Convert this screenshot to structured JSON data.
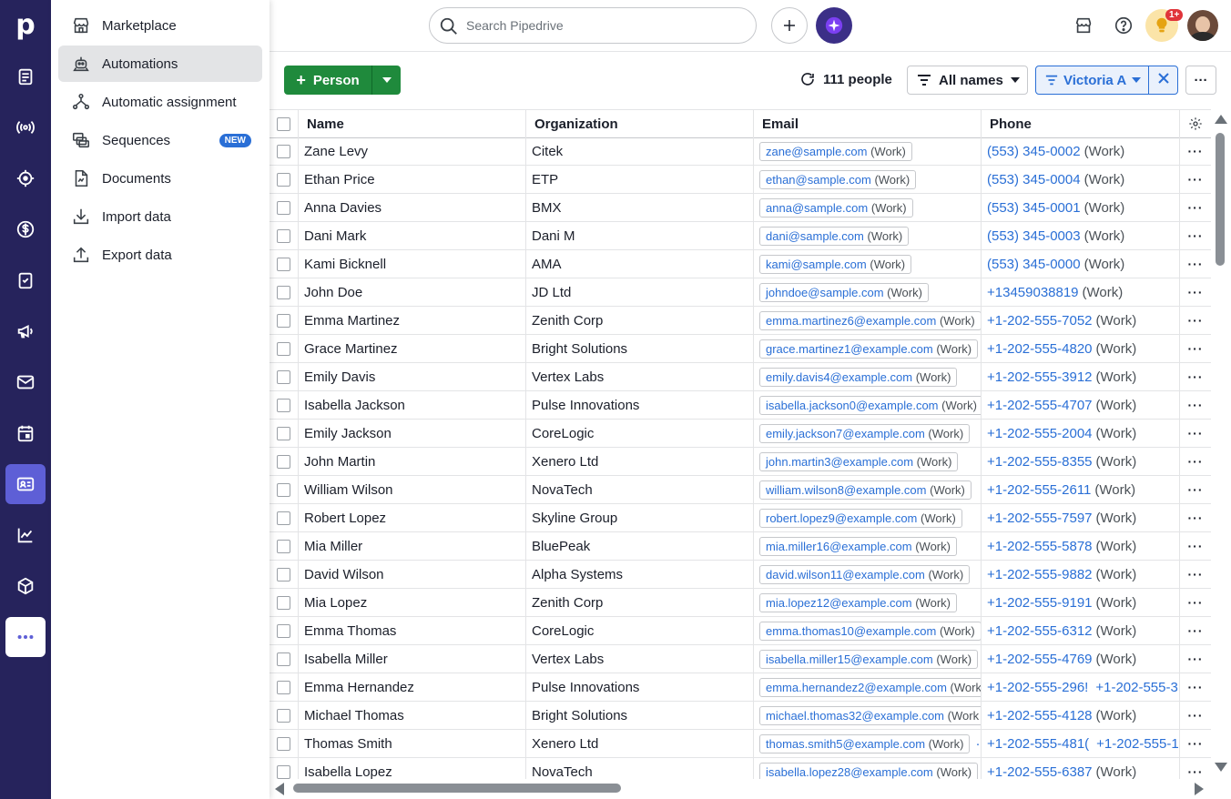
{
  "app": {
    "logo_letter": "p"
  },
  "rail": {
    "items": [
      {
        "name": "leads-icon"
      },
      {
        "name": "campaigns-radar-icon"
      },
      {
        "name": "target-icon"
      },
      {
        "name": "deals-dollar-icon"
      },
      {
        "name": "activities-check-icon"
      },
      {
        "name": "megaphone-icon"
      },
      {
        "name": "mail-icon"
      },
      {
        "name": "calendar-icon"
      },
      {
        "name": "contacts-card-icon"
      },
      {
        "name": "insights-chart-icon"
      },
      {
        "name": "products-box-icon"
      },
      {
        "name": "more-icon"
      }
    ],
    "colors": {
      "rail_bg": "#26235c",
      "active_bg": "#5e5fd6"
    }
  },
  "menu": {
    "items": [
      {
        "label": "Marketplace",
        "icon": "store-icon"
      },
      {
        "label": "Automations",
        "icon": "robot-icon"
      },
      {
        "label": "Automatic assignment",
        "icon": "assignment-icon"
      },
      {
        "label": "Sequences",
        "icon": "sequences-icon",
        "badge": "NEW"
      },
      {
        "label": "Documents",
        "icon": "document-icon"
      },
      {
        "label": "Import data",
        "icon": "import-icon"
      },
      {
        "label": "Export data",
        "icon": "export-icon"
      }
    ]
  },
  "topbar": {
    "search_placeholder": "Search Pipedrive",
    "notification_count": "1+"
  },
  "toolbar": {
    "add_label": "Person",
    "count_label": "111 people",
    "all_names_label": "All names",
    "filter_label": "Victoria A"
  },
  "table": {
    "columns": [
      "Name",
      "Organization",
      "Email",
      "Phone"
    ],
    "rows": [
      {
        "name": "Zane Levy",
        "org": "Citek",
        "email": "zane@sample.com",
        "email_type": "(Work)",
        "phone": "(553) 345-0002",
        "phone_type": "(Work)"
      },
      {
        "name": "Ethan Price",
        "org": "ETP",
        "email": "ethan@sample.com",
        "email_type": "(Work)",
        "phone": "(553) 345-0004",
        "phone_type": "(Work)"
      },
      {
        "name": "Anna Davies",
        "org": "BMX",
        "email": "anna@sample.com",
        "email_type": "(Work)",
        "phone": "(553) 345-0001",
        "phone_type": "(Work)"
      },
      {
        "name": "Dani Mark",
        "org": "Dani M",
        "email": "dani@sample.com",
        "email_type": "(Work)",
        "phone": "(553) 345-0003",
        "phone_type": "(Work)"
      },
      {
        "name": "Kami Bicknell",
        "org": "AMA",
        "email": "kami@sample.com",
        "email_type": "(Work)",
        "phone": "(553) 345-0000",
        "phone_type": "(Work)"
      },
      {
        "name": "John Doe",
        "org": "JD Ltd",
        "email": "johndoe@sample.com",
        "email_type": "(Work)",
        "phone": "+13459038819",
        "phone_type": "(Work)"
      },
      {
        "name": "Emma Martinez",
        "org": "Zenith Corp",
        "email": "emma.martinez6@example.com",
        "email_type": "(Work)",
        "phone": "+1-202-555-7052",
        "phone_type": "(Work)"
      },
      {
        "name": "Grace Martinez",
        "org": "Bright Solutions",
        "email": "grace.martinez1@example.com",
        "email_type": "(Work)",
        "phone": "+1-202-555-4820",
        "phone_type": "(Work)"
      },
      {
        "name": "Emily Davis",
        "org": "Vertex Labs",
        "email": "emily.davis4@example.com",
        "email_type": "(Work)",
        "phone": "+1-202-555-3912",
        "phone_type": "(Work)"
      },
      {
        "name": "Isabella Jackson",
        "org": "Pulse Innovations",
        "email": "isabella.jackson0@example.com",
        "email_type": "(Work)",
        "phone": "+1-202-555-4707",
        "phone_type": "(Work)"
      },
      {
        "name": "Emily Jackson",
        "org": "CoreLogic",
        "email": "emily.jackson7@example.com",
        "email_type": "(Work)",
        "phone": "+1-202-555-2004",
        "phone_type": "(Work)"
      },
      {
        "name": "John Martin",
        "org": "Xenero Ltd",
        "email": "john.martin3@example.com",
        "email_type": "(Work)",
        "phone": "+1-202-555-8355",
        "phone_type": "(Work)"
      },
      {
        "name": "William Wilson",
        "org": "NovaTech",
        "email": "william.wilson8@example.com",
        "email_type": "(Work)",
        "phone": "+1-202-555-2611",
        "phone_type": "(Work)"
      },
      {
        "name": "Robert Lopez",
        "org": "Skyline Group",
        "email": "robert.lopez9@example.com",
        "email_type": "(Work)",
        "phone": "+1-202-555-7597",
        "phone_type": "(Work)"
      },
      {
        "name": "Mia Miller",
        "org": "BluePeak",
        "email": "mia.miller16@example.com",
        "email_type": "(Work)",
        "phone": "+1-202-555-5878",
        "phone_type": "(Work)"
      },
      {
        "name": "David Wilson",
        "org": "Alpha Systems",
        "email": "david.wilson11@example.com",
        "email_type": "(Work)",
        "phone": "+1-202-555-9882",
        "phone_type": "(Work)"
      },
      {
        "name": "Mia Lopez",
        "org": "Zenith Corp",
        "email": "mia.lopez12@example.com",
        "email_type": "(Work)",
        "phone": "+1-202-555-9191",
        "phone_type": "(Work)"
      },
      {
        "name": "Emma Thomas",
        "org": "CoreLogic",
        "email": "emma.thomas10@example.com",
        "email_type": "(Work)",
        "phone": "+1-202-555-6312",
        "phone_type": "(Work)"
      },
      {
        "name": "Isabella Miller",
        "org": "Vertex Labs",
        "email": "isabella.miller15@example.com",
        "email_type": "(Work)",
        "phone": "+1-202-555-4769",
        "phone_type": "(Work)"
      },
      {
        "name": "Emma Hernandez",
        "org": "Pulse Innovations",
        "email": "emma.hernandez2@example.com",
        "email_type": "(Work",
        "phone": "+1-202-555-296!",
        "phone_type": "",
        "phone2": "+1-202-555-3"
      },
      {
        "name": "Michael Thomas",
        "org": "Bright Solutions",
        "email": "michael.thomas32@example.com",
        "email_type": "(Work",
        "phone": "+1-202-555-4128",
        "phone_type": "(Work)"
      },
      {
        "name": "Thomas Smith",
        "org": "Xenero Ltd",
        "email": "thomas.smith5@example.com",
        "email_type": "(Work)",
        "extra": "··",
        "phone": "+1-202-555-481(",
        "phone_type": "",
        "phone2": "+1-202-555-1"
      },
      {
        "name": "Isabella Lopez",
        "org": "NovaTech",
        "email": "isabella.lopez28@example.com",
        "email_type": "(Work)",
        "phone": "+1-202-555-6387",
        "phone_type": "(Work)"
      }
    ]
  },
  "colors": {
    "primary_green": "#1f8a3c",
    "link_blue": "#2a6fd6",
    "badge_red": "#e0343a"
  }
}
